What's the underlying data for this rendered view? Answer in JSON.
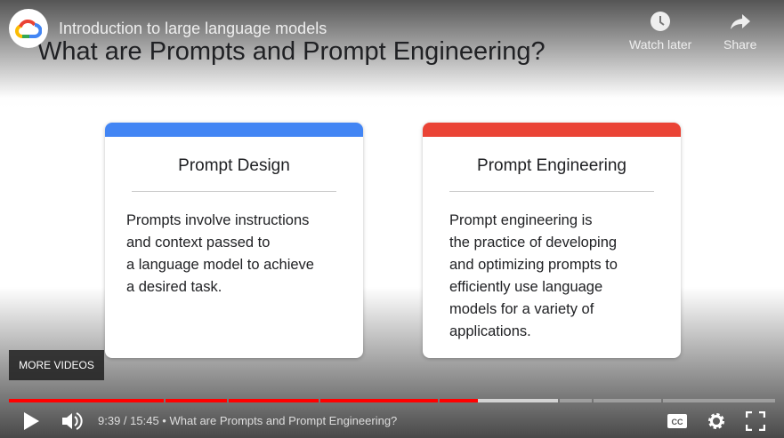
{
  "channel": {
    "logo_icon": "google-cloud-logo"
  },
  "video": {
    "title": "Introduction to large language models"
  },
  "top_actions": [
    {
      "label": "Watch later",
      "icon": "clock-icon"
    },
    {
      "label": "Share",
      "icon": "share-arrow-icon"
    }
  ],
  "slide": {
    "title": "What are Prompts and Prompt Engineering?",
    "cards": [
      {
        "heading": "Prompt Design",
        "color": "#4285f4",
        "lines": [
          "Prompts involve instructions",
          "and context passed to",
          "a language model to achieve",
          "a desired task."
        ]
      },
      {
        "heading": "Prompt Engineering",
        "color": "#ea4335",
        "lines": [
          "Prompt engineering is",
          "the practice of developing",
          "and optimizing prompts to",
          "efficiently use language",
          "models for a variety of",
          "applications."
        ]
      }
    ]
  },
  "more_videos": "MORE VIDEOS",
  "player": {
    "current": "9:39",
    "duration": "15:45",
    "time_display": "9:39 / 15:45",
    "chapter": "What are Prompts and Prompt Engineering?",
    "separator": "•",
    "progress_percent": 61.2,
    "buffered_percent": 71.7,
    "accent": "#ff0000"
  }
}
